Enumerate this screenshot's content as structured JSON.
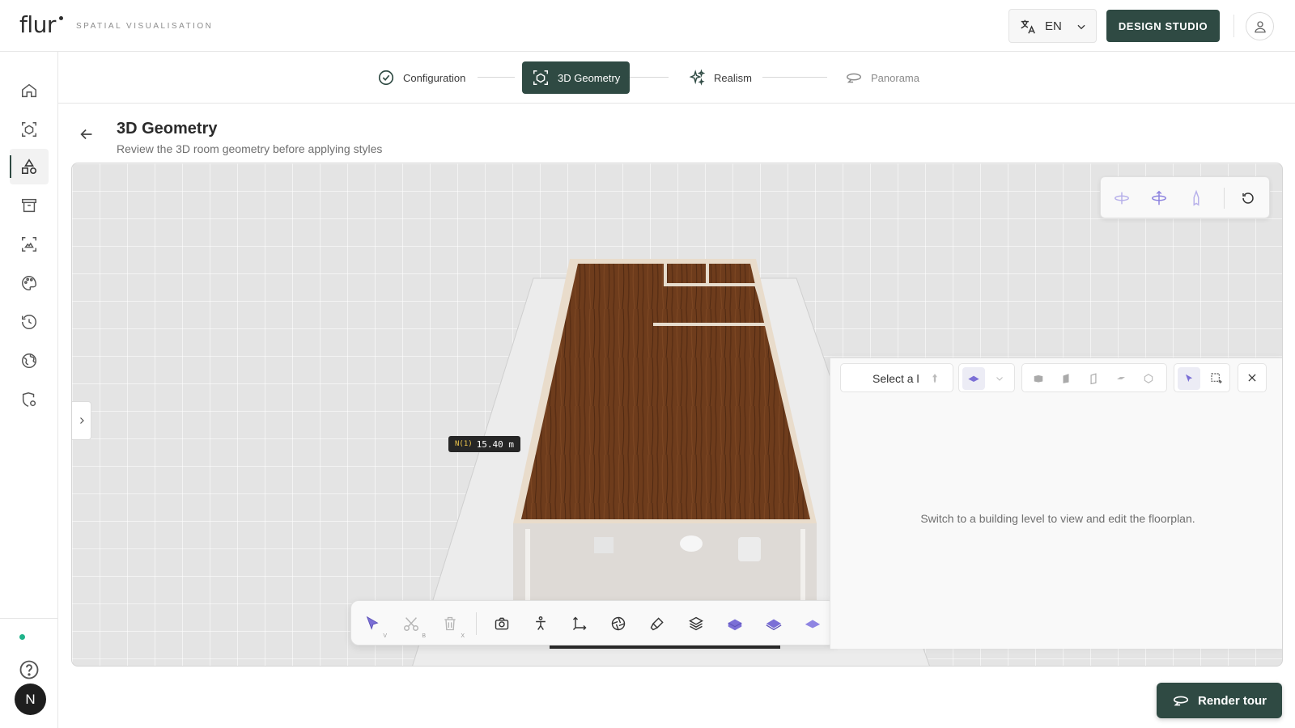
{
  "brand": {
    "logo": "flur",
    "tagline": "SPATIAL VISUALISATION"
  },
  "header": {
    "language": "EN",
    "language_icon": "translate-icon",
    "studio_button": "DESIGN STUDIO",
    "profile_icon": "user-icon"
  },
  "sidebar": {
    "items": [
      {
        "icon": "home-icon",
        "active": false
      },
      {
        "icon": "cube-scan-icon",
        "active": false
      },
      {
        "icon": "shapes-icon",
        "active": true
      },
      {
        "icon": "archive-icon",
        "active": false
      },
      {
        "icon": "image-scan-icon",
        "active": false
      },
      {
        "icon": "palette-icon",
        "active": false
      },
      {
        "icon": "history-icon",
        "active": false
      },
      {
        "icon": "globe-icon",
        "active": false
      },
      {
        "icon": "shield-settings-icon",
        "active": false
      }
    ],
    "status_color": "#1fb38a",
    "help_icon": "help-icon",
    "user_initial": "N"
  },
  "stepper": {
    "steps": [
      {
        "label": "Configuration",
        "state": "done"
      },
      {
        "label": "3D Geometry",
        "state": "active"
      },
      {
        "label": "Realism",
        "state": "pending"
      },
      {
        "label": "Panorama",
        "state": "disabled"
      }
    ]
  },
  "page": {
    "title": "3D Geometry",
    "subtitle": "Review the 3D room geometry before applying styles"
  },
  "viewport": {
    "measurement_tag": "N(1)",
    "measurement_value": "15.40 m",
    "camera_controls": [
      "orbit-horizontal-icon",
      "orbit-vertical-icon",
      "tilt-icon",
      "reset-view-icon"
    ],
    "toolbar": [
      {
        "icon": "select-icon",
        "key": "V"
      },
      {
        "icon": "cut-icon",
        "key": "B"
      },
      {
        "icon": "delete-icon",
        "key": "X"
      },
      {
        "icon": "camera-icon",
        "key": ""
      },
      {
        "icon": "person-icon",
        "key": ""
      },
      {
        "icon": "axes-icon",
        "key": ""
      },
      {
        "icon": "aperture-icon",
        "key": ""
      },
      {
        "icon": "paint-icon",
        "key": ""
      },
      {
        "icon": "layers-icon",
        "key": ""
      },
      {
        "icon": "floor-box-icon",
        "key": ""
      },
      {
        "icon": "floor-stack-icon",
        "key": ""
      },
      {
        "icon": "floor-plane-icon",
        "key": ""
      }
    ]
  },
  "floorplan_panel": {
    "level_placeholder": "Select a l",
    "empty_message": "Switch to a building level to view and edit the floorplan."
  },
  "actions": {
    "render_tour": "Render tour"
  },
  "colors": {
    "accent": "#2f4a43",
    "tool_accent": "#7b6fd6",
    "wood": "#6b3a1a"
  }
}
